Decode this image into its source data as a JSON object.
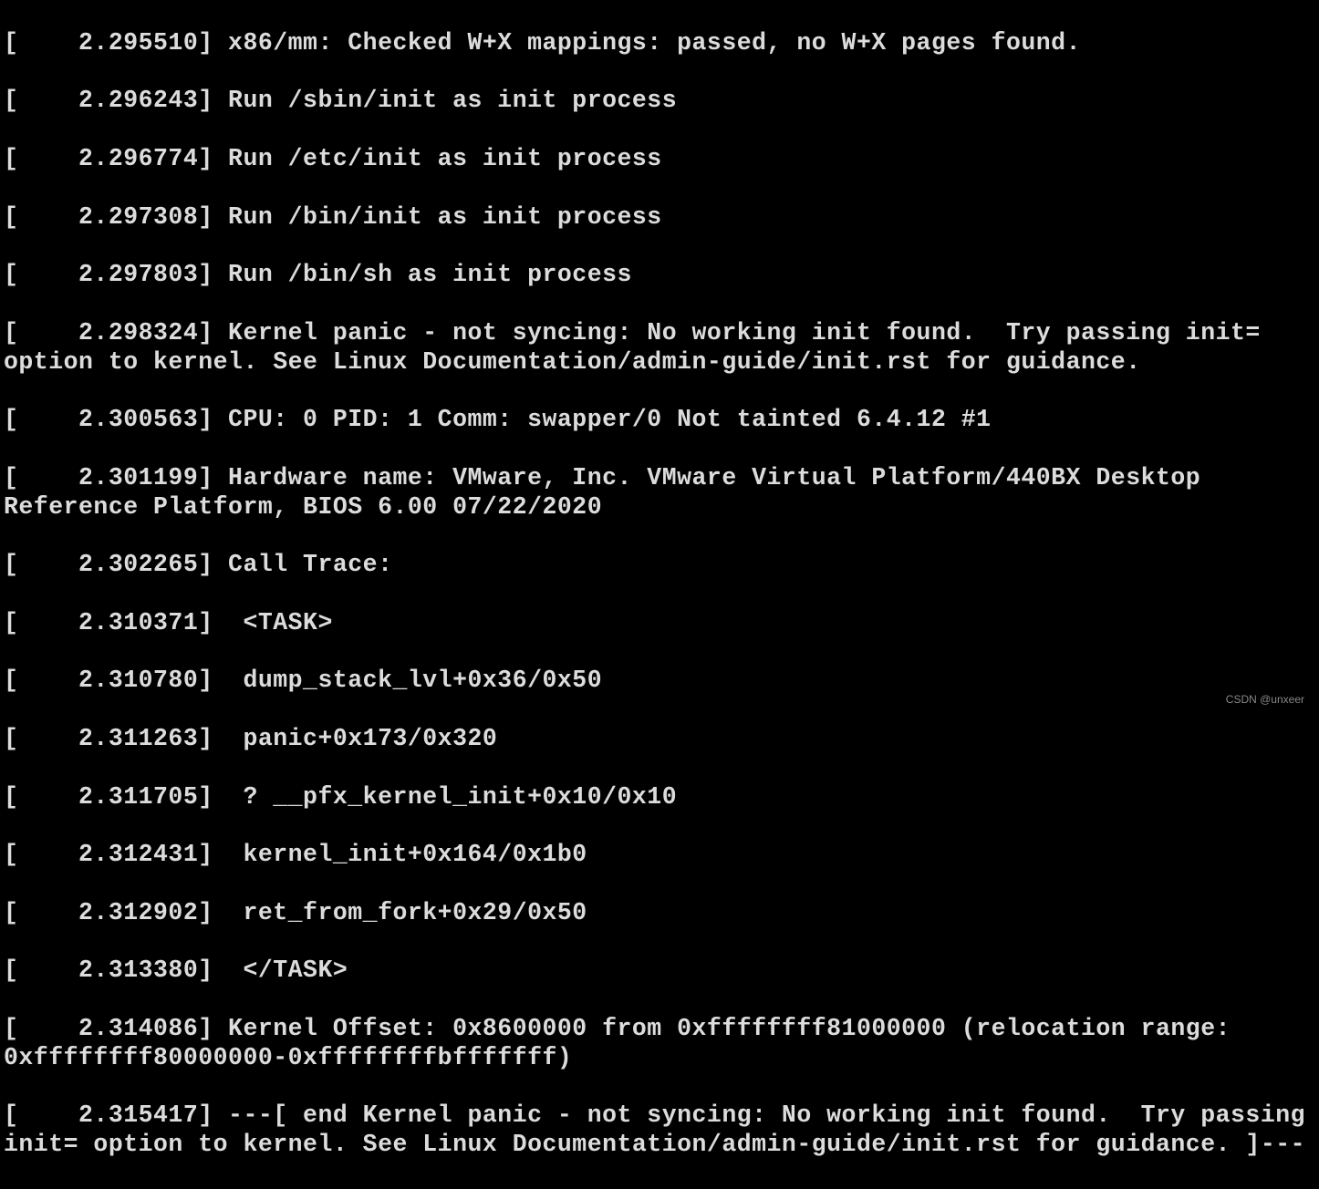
{
  "terminal": {
    "lines": [
      "[    2.295510] x86/mm: Checked W+X mappings: passed, no W+X pages found.",
      "[    2.296243] Run /sbin/init as init process",
      "[    2.296774] Run /etc/init as init process",
      "[    2.297308] Run /bin/init as init process",
      "[    2.297803] Run /bin/sh as init process",
      "[    2.298324] Kernel panic - not syncing: No working init found.  Try passing init= option to kernel. See Linux Documentation/admin-guide/init.rst for guidance.",
      "[    2.300563] CPU: 0 PID: 1 Comm: swapper/0 Not tainted 6.4.12 #1",
      "[    2.301199] Hardware name: VMware, Inc. VMware Virtual Platform/440BX Desktop Reference Platform, BIOS 6.00 07/22/2020",
      "[    2.302265] Call Trace:",
      "[    2.310371]  <TASK>",
      "[    2.310780]  dump_stack_lvl+0x36/0x50",
      "[    2.311263]  panic+0x173/0x320",
      "[    2.311705]  ? __pfx_kernel_init+0x10/0x10",
      "[    2.312431]  kernel_init+0x164/0x1b0",
      "[    2.312902]  ret_from_fork+0x29/0x50",
      "[    2.313380]  </TASK>",
      "[    2.314086] Kernel Offset: 0x8600000 from 0xffffffff81000000 (relocation range: 0xffffffff80000000-0xffffffffbfffffff)",
      "[    2.315417] ---[ end Kernel panic - not syncing: No working init found.  Try passing init= option to kernel. See Linux Documentation/admin-guide/init.rst for guidance. ]---"
    ]
  },
  "watermark": "CSDN @unxeer"
}
